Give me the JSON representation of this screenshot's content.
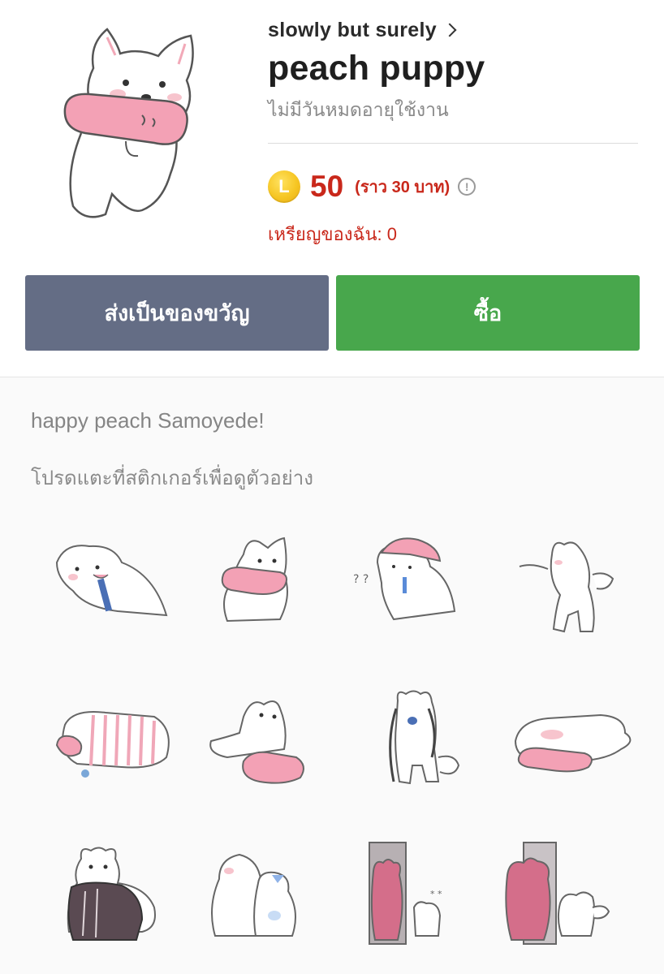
{
  "product": {
    "author": "slowly but surely",
    "title": "peach puppy",
    "validity": "ไม่มีวันหมดอายุใช้งาน",
    "coin_letter": "L",
    "price": "50",
    "price_approx": "(ราว  30 บาท)",
    "my_coins": "เหรียญของฉัน: 0"
  },
  "buttons": {
    "gift": "ส่งเป็นของขวัญ",
    "buy": "ซื้อ"
  },
  "description": "happy peach Samoyede!",
  "hint": "โปรดแตะที่สติกเกอร์เพื่อดูตัวอย่าง",
  "stickers": [
    "samoyed-licking-sticker",
    "samoyed-holding-pillow-sticker",
    "samoyed-confused-cap-sticker",
    "samoyed-dancing-sticker",
    "samoyed-sleeping-blanket-sticker",
    "samoyed-lying-pillow-sticker",
    "samoyed-leash-sticker",
    "samoyed-relaxing-sticker",
    "samoyed-sweater-sticker",
    "samoyed-cuddling-cat-sticker",
    "samoyed-door-bear-sticker",
    "samoyed-bear-pillow-sticker"
  ],
  "colors": {
    "gift_button": "#646d85",
    "buy_button": "#48a74c",
    "price_red": "#c9281b",
    "coin_gold": "#f6c623"
  }
}
